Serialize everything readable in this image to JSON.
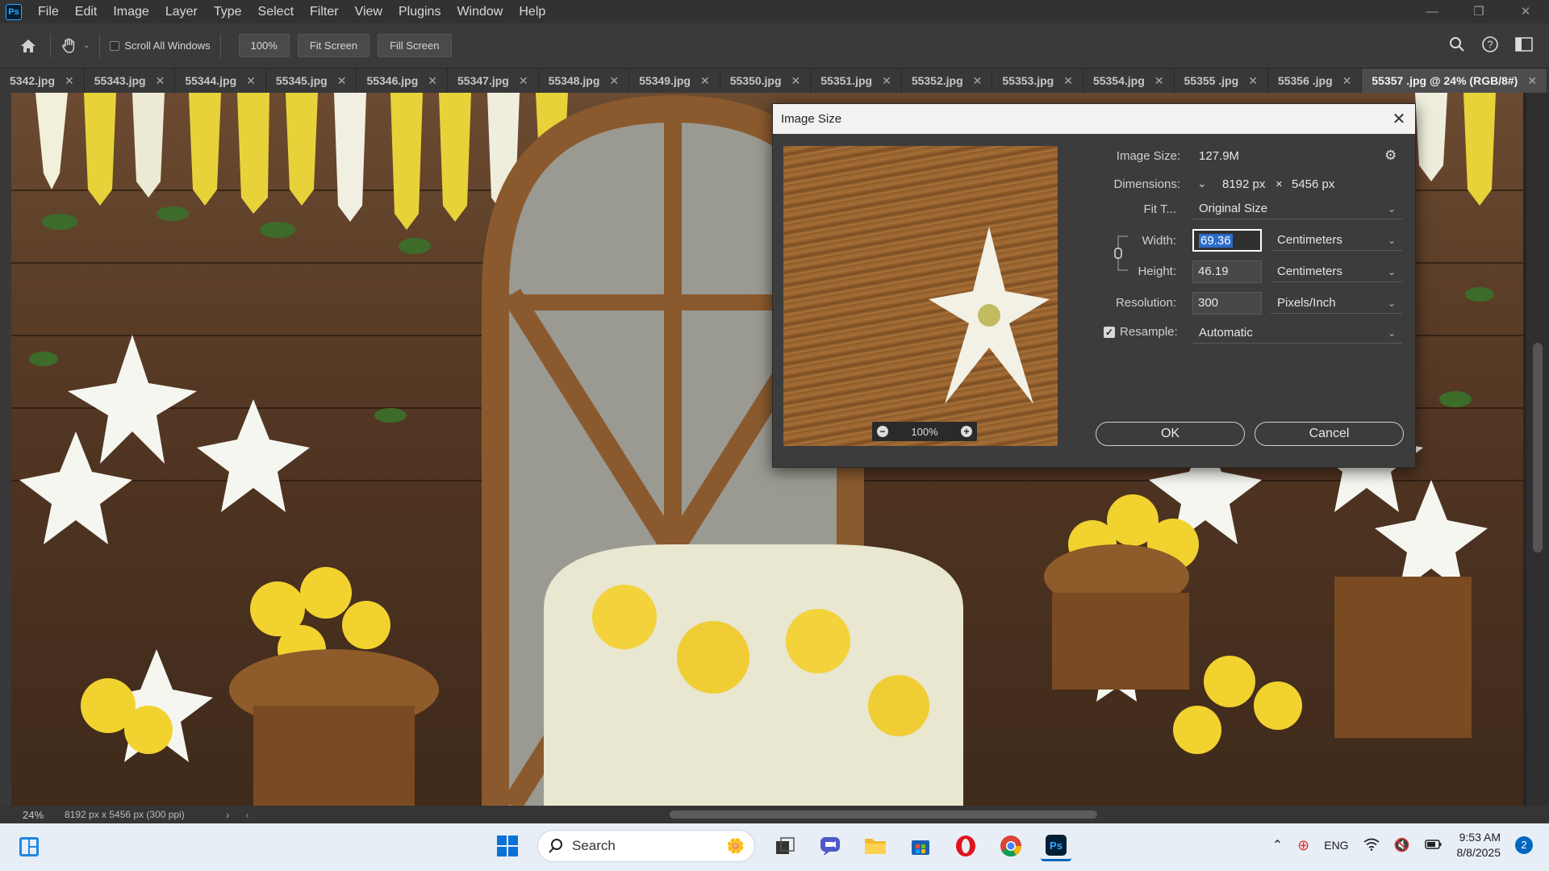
{
  "app": {
    "logo": "Ps",
    "menu": [
      "File",
      "Edit",
      "Image",
      "Layer",
      "Type",
      "Select",
      "Filter",
      "View",
      "Plugins",
      "Window",
      "Help"
    ]
  },
  "options_bar": {
    "scroll_all_windows": "Scroll All Windows",
    "zoom_value": "100%",
    "fit_screen": "Fit Screen",
    "fill_screen": "Fill Screen"
  },
  "tabs": [
    {
      "label": "5342.jpg"
    },
    {
      "label": "55343.jpg"
    },
    {
      "label": "55344.jpg"
    },
    {
      "label": "55345.jpg"
    },
    {
      "label": "55346.jpg"
    },
    {
      "label": "55347.jpg"
    },
    {
      "label": "55348.jpg"
    },
    {
      "label": "55349.jpg"
    },
    {
      "label": "55350.jpg"
    },
    {
      "label": "55351.jpg"
    },
    {
      "label": "55352.jpg"
    },
    {
      "label": "55353.jpg"
    },
    {
      "label": "55354.jpg"
    },
    {
      "label": "55355 .jpg"
    },
    {
      "label": "55356 .jpg"
    },
    {
      "label": "55357 .jpg @ 24% (RGB/8#)",
      "active": true
    }
  ],
  "status": {
    "zoom": "24%",
    "info": "8192 px x 5456 px (300 ppi)"
  },
  "dialog": {
    "title": "Image Size",
    "preview_zoom": "100%",
    "image_size_label": "Image Size:",
    "image_size_value": "127.9M",
    "dimensions_label": "Dimensions:",
    "dim_width": "8192 px",
    "dim_x": "×",
    "dim_height": "5456 px",
    "fit_to_label": "Fit T...",
    "fit_to_value": "Original Size",
    "width_label": "Width:",
    "width_value": "69.36",
    "width_unit": "Centimeters",
    "height_label": "Height:",
    "height_value": "46.19",
    "height_unit": "Centimeters",
    "resolution_label": "Resolution:",
    "resolution_value": "300",
    "resolution_unit": "Pixels/Inch",
    "resample_label": "Resample:",
    "resample_value": "Automatic",
    "ok": "OK",
    "cancel": "Cancel"
  },
  "taskbar": {
    "search": "Search",
    "lang": "ENG",
    "time": "9:53 AM",
    "date": "8/8/2025",
    "notifications": "2"
  }
}
